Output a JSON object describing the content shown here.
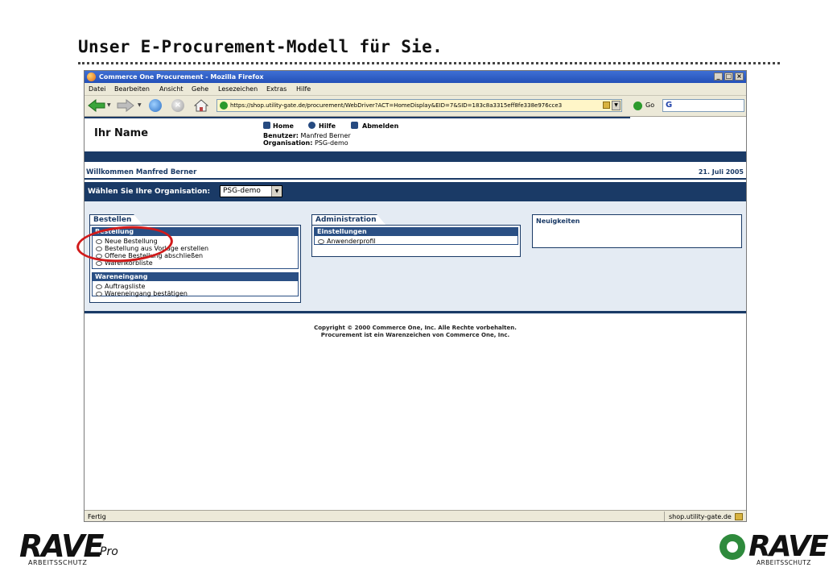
{
  "slide": {
    "title": "Unser E-Procurement-Modell für Sie."
  },
  "browser": {
    "window_title": "Commerce One Procurement - Mozilla Firefox",
    "menu": [
      "Datei",
      "Bearbeiten",
      "Ansicht",
      "Gehe",
      "Lesezeichen",
      "Extras",
      "Hilfe"
    ],
    "url": "https://shop.utility-gate.de/procurement/WebDriver?ACT=HomeDisplay&EID=7&SID=183c8a3315eff8fe338e976cce3",
    "go_label": "Go",
    "search_engine_glyph": "G",
    "status_left": "Fertig",
    "status_right": "shop.utility-gate.de"
  },
  "page": {
    "your_name": "Ihr Name",
    "nav": {
      "home": "Home",
      "help": "Hilfe",
      "logout": "Abmelden"
    },
    "user_label": "Benutzer:",
    "user_value": "Manfred Berner",
    "org_label": "Organisation:",
    "org_value": "PSG-demo",
    "welcome": "Willkommen Manfred Berner",
    "date": "21. Juli 2005",
    "choose_org_label": "Wählen Sie Ihre Organisation:",
    "choose_org_value": "PSG-demo",
    "panels": {
      "bestellen": {
        "tab": "Bestellen",
        "sections": [
          {
            "head": "Bestellung",
            "items": [
              "Neue Bestellung",
              "Bestellung aus Vorlage erstellen",
              "Offene Bestellung abschließen",
              "Warenkorbliste"
            ]
          },
          {
            "head": "Wareneingang",
            "items": [
              "Auftragsliste",
              "Wareneingang bestätigen"
            ]
          }
        ]
      },
      "administration": {
        "tab": "Administration",
        "sections": [
          {
            "head": "Einstellungen",
            "items": [
              "Anwenderprofil"
            ]
          }
        ]
      },
      "news": {
        "head": "Neuigkeiten"
      }
    },
    "copyright_line1": "Copyright © 2000 Commerce One, Inc. Alle Rechte vorbehalten.",
    "copyright_line2": "Procurement ist ein Warenzeichen von Commerce One, Inc."
  },
  "logos": {
    "left_brand": "RAVE",
    "left_suffix": "Pro",
    "left_sub": "ARBEITSSCHUTZ",
    "right_brand": "RAVE",
    "right_sub": "ARBEITSSCHUTZ"
  },
  "colors": {
    "accent_dark_blue": "#1a3a66",
    "highlight_red": "#d11a1a",
    "rave_green": "#2e8a3c"
  }
}
